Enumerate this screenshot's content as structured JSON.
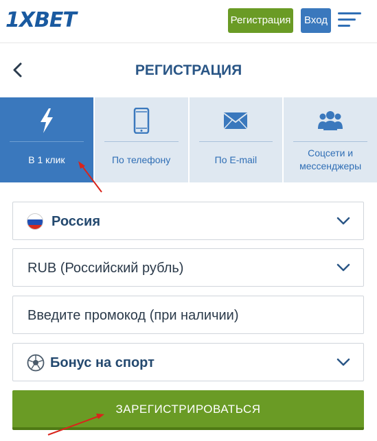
{
  "header": {
    "logo_text": "1XBET",
    "register_label": "Регистрация",
    "login_label": "Вход",
    "menu_icon": "hamburger-icon"
  },
  "page": {
    "title": "РЕГИСТРАЦИЯ",
    "back_icon": "chevron-left-icon"
  },
  "tabs": [
    {
      "label": "В 1 клик",
      "icon": "lightning-icon",
      "active": true
    },
    {
      "label": "По телефону",
      "icon": "phone-icon",
      "active": false
    },
    {
      "label": "По E-mail",
      "icon": "envelope-icon",
      "active": false
    },
    {
      "label": "Соцсети и мессенджеры",
      "label_line1": "Соцсети и",
      "label_line2": "мессенджеры",
      "icon": "users-icon",
      "active": false
    }
  ],
  "form": {
    "country": {
      "value": "Россия",
      "icon": "russia-flag-icon"
    },
    "currency": {
      "value": "RUB (Российский рубль)"
    },
    "promo": {
      "placeholder": "Введите промокод (при наличии)"
    },
    "bonus": {
      "value": "Бонус на спорт",
      "icon": "soccer-ball-icon"
    },
    "submit_label": "ЗАРЕГИСТРИРОВАТЬСЯ"
  },
  "colors": {
    "brand_blue": "#3a78bd",
    "title_blue": "#2a5686",
    "green": "#6a9b25",
    "tab_inactive_bg": "#dfe8f1",
    "annotation_arrow": "#d9241b"
  }
}
